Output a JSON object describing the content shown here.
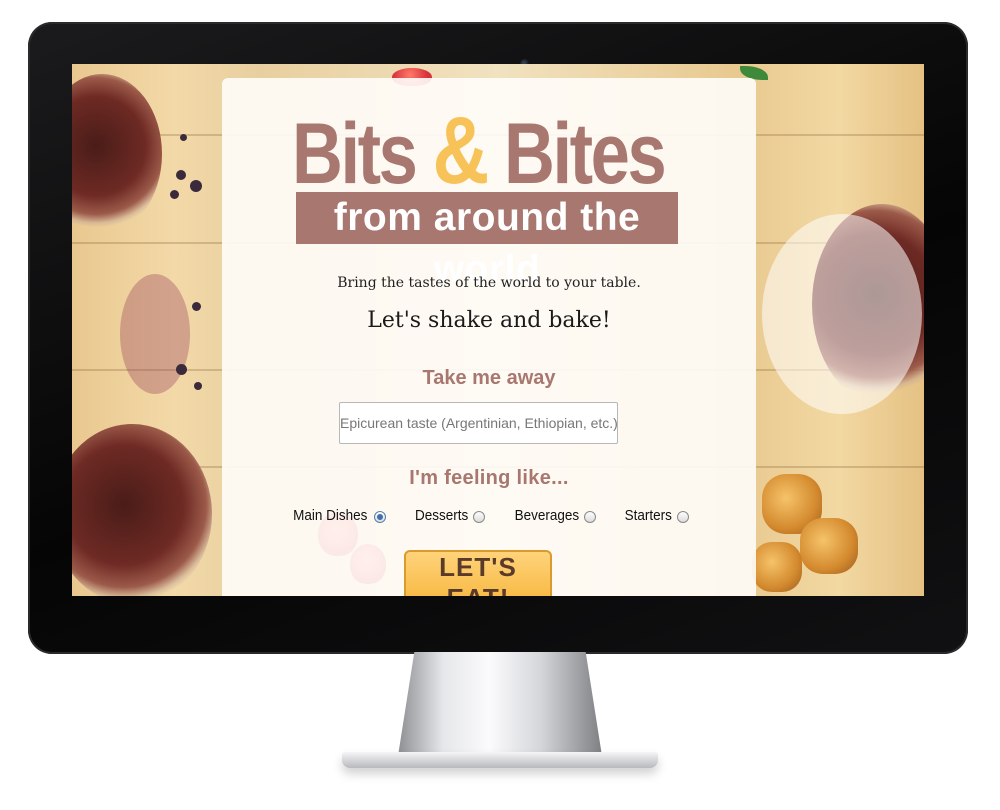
{
  "site": {
    "logo": {
      "word1": "Bits",
      "ampersand": "&",
      "word2": "Bites",
      "subtitle": "from around the world"
    },
    "tagline": "Bring the tastes of the world to your table.",
    "motto": "Let's shake and bake!",
    "search": {
      "label": "Take me away",
      "placeholder": "Epicurean taste (Argentinian, Ethiopian, etc.)"
    },
    "feeling": {
      "label": "I'm feeling like...",
      "options": [
        {
          "label": "Main Dishes",
          "checked": true
        },
        {
          "label": "Desserts",
          "checked": false
        },
        {
          "label": "Beverages",
          "checked": false
        },
        {
          "label": "Starters",
          "checked": false
        }
      ]
    },
    "cta_label": "LET'S EAT!"
  },
  "colors": {
    "brand_mauve": "#a8776f",
    "accent_yellow": "#f7c358",
    "button_fill": "#f7b944"
  }
}
